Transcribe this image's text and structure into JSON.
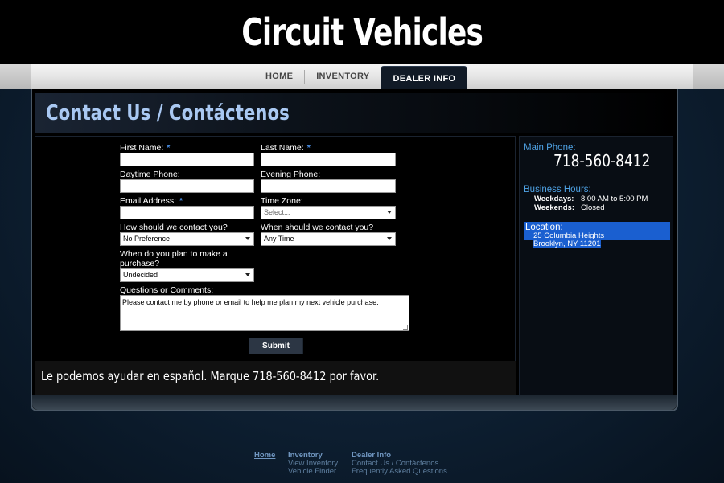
{
  "brand": {
    "logo": "Circuit Vehicles"
  },
  "nav": {
    "items": [
      {
        "label": "HOME"
      },
      {
        "label": "INVENTORY"
      },
      {
        "label": "DEALER INFO",
        "active": true
      }
    ]
  },
  "page": {
    "title": "Contact Us / Contáctenos"
  },
  "form": {
    "first_name": {
      "label": "First Name:",
      "required": "*",
      "value": ""
    },
    "last_name": {
      "label": "Last Name:",
      "required": "*",
      "value": ""
    },
    "daytime_phone": {
      "label": "Daytime Phone:",
      "value": ""
    },
    "evening_phone": {
      "label": "Evening Phone:",
      "value": ""
    },
    "email": {
      "label": "Email Address:",
      "required": "*",
      "value": ""
    },
    "time_zone": {
      "label": "Time Zone:",
      "selected": "Select..."
    },
    "contact_method": {
      "label": "How should we contact you?",
      "selected": "No Preference"
    },
    "contact_time": {
      "label": "When should we contact you?",
      "selected": "Any Time"
    },
    "purchase_plan": {
      "label_line1": "When do you plan to make a",
      "label_line2": "purchase?",
      "selected": "Undecided"
    },
    "comments": {
      "label": "Questions or Comments:",
      "value": "Please contact me by phone or email to help me plan my next vehicle purchase."
    },
    "submit_label": "Submit"
  },
  "spanish_note": "Le podemos ayudar en español.  Marque 718-560-8412 por favor.",
  "sidebar": {
    "main_phone_label": "Main Phone:",
    "main_phone": "718-560-8412",
    "hours_label": "Business Hours:",
    "hours": [
      {
        "day": "Weekdays:",
        "time": "8:00 AM to 5:00 PM"
      },
      {
        "day": "Weekends:",
        "time": "Closed"
      }
    ],
    "location_label": "Location:",
    "address_line1": "25 Columbia Heights",
    "address_line2": "Brooklyn, NY 11201"
  },
  "footer": {
    "home": "Home",
    "inventory": {
      "head": "Inventory",
      "links": [
        "View Inventory",
        "Vehicle Finder"
      ]
    },
    "dealer": {
      "head": "Dealer Info",
      "links": [
        "Contact Us / Contáctenos",
        "Frequently Asked Questions"
      ]
    }
  },
  "colors": {
    "accent_blue": "#4fa3e6",
    "title_blue": "#a9c8f2",
    "location_highlight": "#1a5fd0",
    "required_star": "#4a8fe7"
  }
}
